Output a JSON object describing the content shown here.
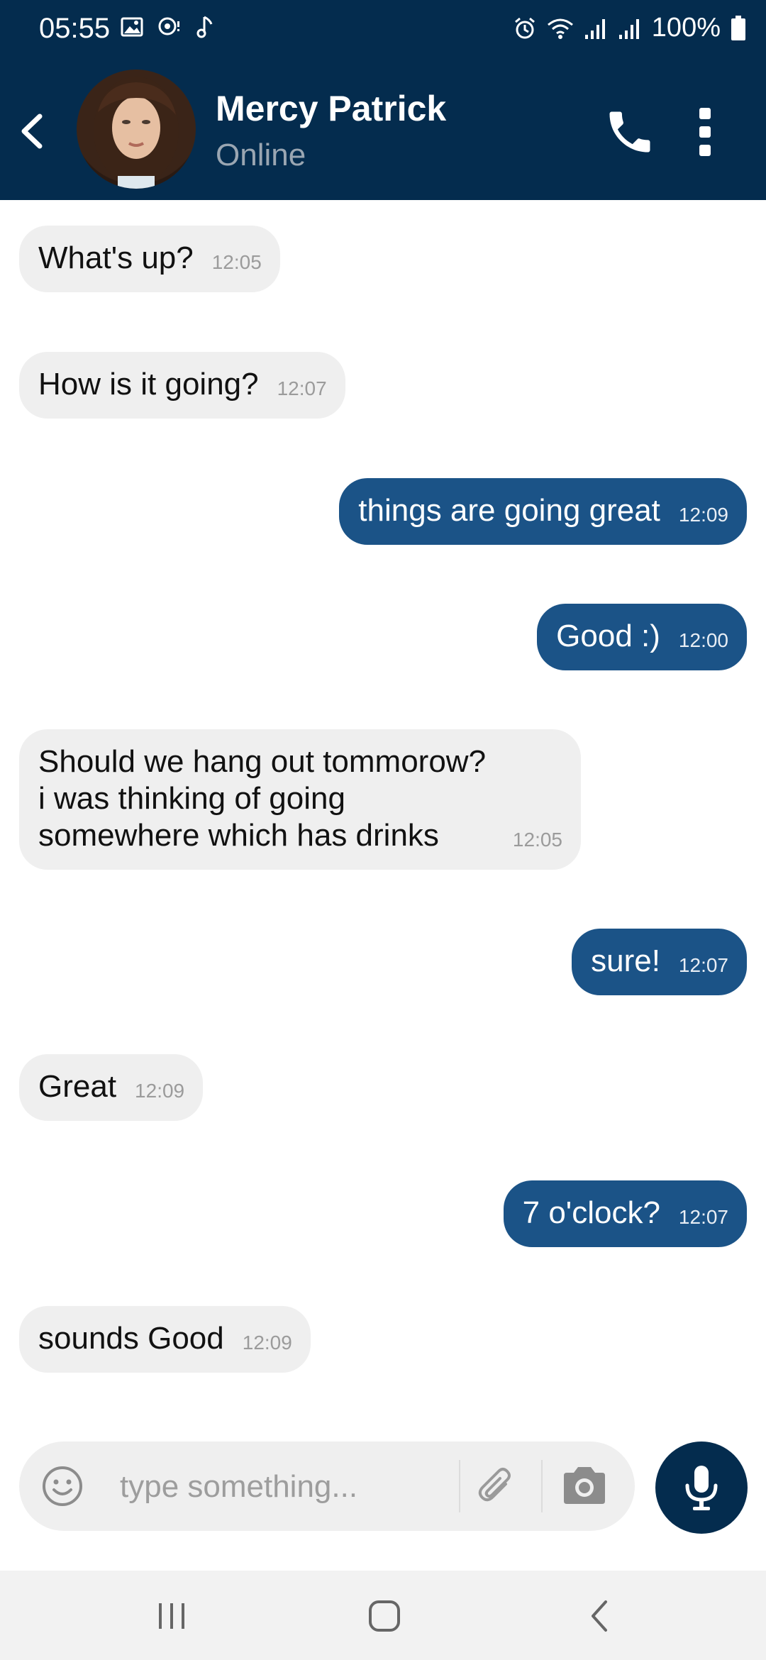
{
  "status_bar": {
    "time": "05:55",
    "battery": "100%"
  },
  "header": {
    "name": "Mercy Patrick",
    "status": "Online"
  },
  "messages": [
    {
      "dir": "in",
      "text": "What's up?",
      "time": "12:05"
    },
    {
      "dir": "in",
      "text": "How is it going?",
      "time": "12:07"
    },
    {
      "dir": "out",
      "text": "things are going great",
      "time": "12:09"
    },
    {
      "dir": "out",
      "text": "Good :)",
      "time": "12:00"
    },
    {
      "dir": "in",
      "text": "Should we hang out tommorow?\ni was thinking of going\nsomewhere which has drinks",
      "time": "12:05"
    },
    {
      "dir": "out",
      "text": "sure!",
      "time": "12:07"
    },
    {
      "dir": "in",
      "text": "Great",
      "time": "12:09"
    },
    {
      "dir": "out",
      "text": "7 o'clock?",
      "time": "12:07"
    },
    {
      "dir": "in",
      "text": "sounds Good",
      "time": "12:09"
    }
  ],
  "composer": {
    "placeholder": "type something..."
  },
  "colors": {
    "header_bg": "#042c4e",
    "outgoing_bubble": "#1b5387",
    "incoming_bubble": "#efefef"
  }
}
